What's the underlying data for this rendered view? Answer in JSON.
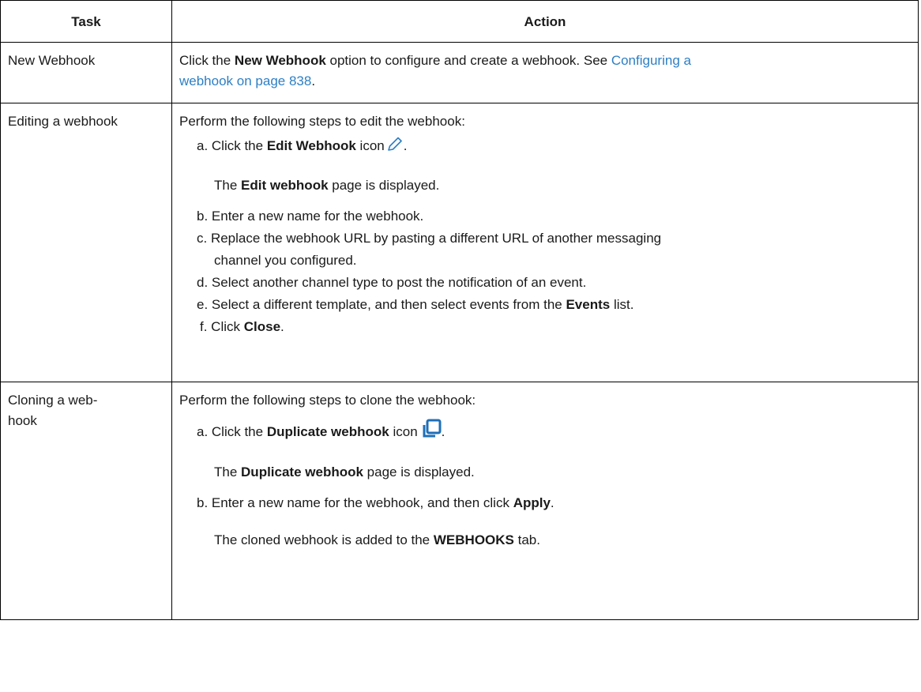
{
  "header": {
    "task": "Task",
    "action": "Action"
  },
  "rows": [
    {
      "task": "New Webhook",
      "a_pre": "Click the ",
      "a_bold": "New Webhook",
      "a_mid": " option to configure and create a webhook. See ",
      "a_link1": "Configuring a",
      "a_link2": "webhook on page 838",
      "a_end": "."
    },
    {
      "task": "Editing a webhook",
      "intro": "Perform the following steps to edit the webhook:",
      "s_a_pre": "a. Click the ",
      "s_a_bold": "Edit Webhook",
      "s_a_post": " icon",
      "s_a_end": ".",
      "s_a_note_pre": "The ",
      "s_a_note_bold": "Edit webhook",
      "s_a_note_post": " page is displayed.",
      "s_b": "b. Enter a new name for the webhook.",
      "s_c1": "c. Replace the webhook URL by pasting a different URL of another messaging",
      "s_c2": "channel you configured.",
      "s_d": "d. Select another channel type to post the notification of an event.",
      "s_e_pre": "e. Select a different template, and then select events from the ",
      "s_e_bold": "Events",
      "s_e_post": " list.",
      "s_f_pre": "f. Click ",
      "s_f_bold": "Close",
      "s_f_post": "."
    },
    {
      "task1": "Cloning a web-",
      "task2": "hook",
      "intro": "Perform the following steps to clone the webhook:",
      "s_a_pre": "a. Click the ",
      "s_a_bold": "Duplicate webhook",
      "s_a_post": " icon",
      "s_a_end": ".",
      "s_a_note_pre": "The ",
      "s_a_note_bold": "Duplicate webhook",
      "s_a_note_post": " page is displayed.",
      "s_b_pre": "b. Enter a new name for the webhook, and then click ",
      "s_b_bold": "Apply",
      "s_b_post": ".",
      "s_b_note_pre": "The cloned webhook is added to the ",
      "s_b_note_bold": "WEBHOOKS",
      "s_b_note_post": " tab."
    }
  ],
  "icons": {
    "edit": "pencil-icon",
    "duplicate": "duplicate-icon",
    "accent": "#2d7fc4"
  }
}
